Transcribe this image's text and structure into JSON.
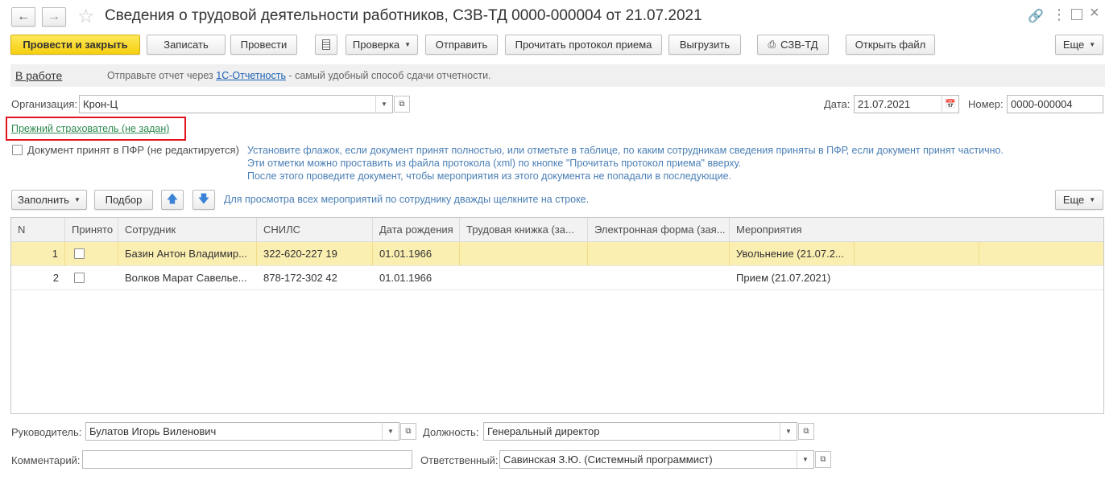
{
  "window": {
    "title": "Сведения о трудовой деятельности работников, СЗВ-ТД 0000-000004 от 21.07.2021"
  },
  "toolbar": {
    "post_close": "Провести и закрыть",
    "save": "Записать",
    "post": "Провести",
    "check": "Проверка",
    "send": "Отправить",
    "read_protocol": "Прочитать протокол приема",
    "export": "Выгрузить",
    "print_szv": "СЗВ-ТД",
    "open_file": "Открыть файл",
    "more": "Еще"
  },
  "status": {
    "state": "В работе",
    "message_prefix": "Отправьте отчет через",
    "link": "1С-Отчетность",
    "message_suffix": "- самый удобный способ сдачи отчетности."
  },
  "form": {
    "org_label": "Организация:",
    "org_value": "Крон-Ц",
    "date_label": "Дата:",
    "date_value": "21.07.2021",
    "number_label": "Номер:",
    "number_value": "0000-000004",
    "prev_insurer_link": "Прежний страхователь (не задан)",
    "accepted_label": "Документ принят в ПФР (не редактируется)",
    "hint_lines": [
      "Установите флажок, если документ принят полностью, или отметьте в таблице, по каким сотрудникам сведения приняты в ПФР, если документ принят частично.",
      "Эти отметки можно проставить из файла протокола (xml) по кнопке \"Прочитать протокол приема\" вверху.",
      "После этого проведите документ, чтобы мероприятия из этого документа не попадали в последующие."
    ]
  },
  "table_toolbar": {
    "fill": "Заполнить",
    "pick": "Подбор",
    "hint": "Для просмотра всех мероприятий по сотруднику дважды щелкните на строке.",
    "more": "Еще"
  },
  "table": {
    "columns": [
      "N",
      "Принято",
      "Сотрудник",
      "СНИЛС",
      "Дата рождения",
      "Трудовая книжка (за...",
      "Электронная форма (зая...",
      "Мероприятия"
    ],
    "rows": [
      {
        "n": "1",
        "employee": "Базин Антон Владимир...",
        "snils": "322-620-227 19",
        "birth": "01.01.1966",
        "book": "",
        "eform": "",
        "events": "Увольнение (21.07.2..."
      },
      {
        "n": "2",
        "employee": "Волков Марат Савелье...",
        "snils": "878-172-302 42",
        "birth": "01.01.1966",
        "book": "",
        "eform": "",
        "events": "Прием (21.07.2021)"
      }
    ]
  },
  "footer": {
    "head_label": "Руководитель:",
    "head_value": "Булатов Игорь Виленович",
    "position_label": "Должность:",
    "position_value": "Генеральный директор",
    "comment_label": "Комментарий:",
    "comment_value": "",
    "responsible_label": "Ответственный:",
    "responsible_value": "Савинская З.Ю. (Системный программист)"
  }
}
